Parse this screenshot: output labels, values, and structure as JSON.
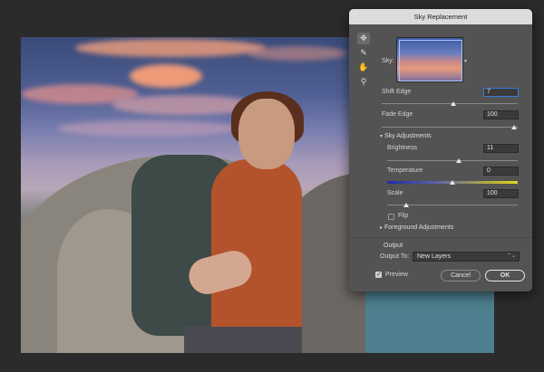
{
  "dialog": {
    "title": "Sky Replacement",
    "tools": [
      "move-tool",
      "sky-brush-tool",
      "hand-tool",
      "zoom-tool"
    ],
    "sky": {
      "label": "Sky:"
    },
    "shift_edge": {
      "label": "Shift Edge",
      "value": "7"
    },
    "fade_edge": {
      "label": "Fade Edge",
      "value": "100"
    },
    "sky_adjustments": {
      "header": "Sky Adjustments",
      "brightness": {
        "label": "Brightness",
        "value": "11"
      },
      "temperature": {
        "label": "Temperature",
        "value": "0"
      },
      "scale": {
        "label": "Scale",
        "value": "100"
      },
      "flip": {
        "label": "Flip",
        "checked": false
      }
    },
    "foreground_adjustments": {
      "header": "Foreground Adjustments"
    },
    "output": {
      "header": "Output",
      "output_to_label": "Output To:",
      "output_to_value": "New Layers"
    },
    "preview": {
      "label": "Preview",
      "checked": true
    },
    "buttons": {
      "cancel": "Cancel",
      "ok": "OK"
    }
  }
}
